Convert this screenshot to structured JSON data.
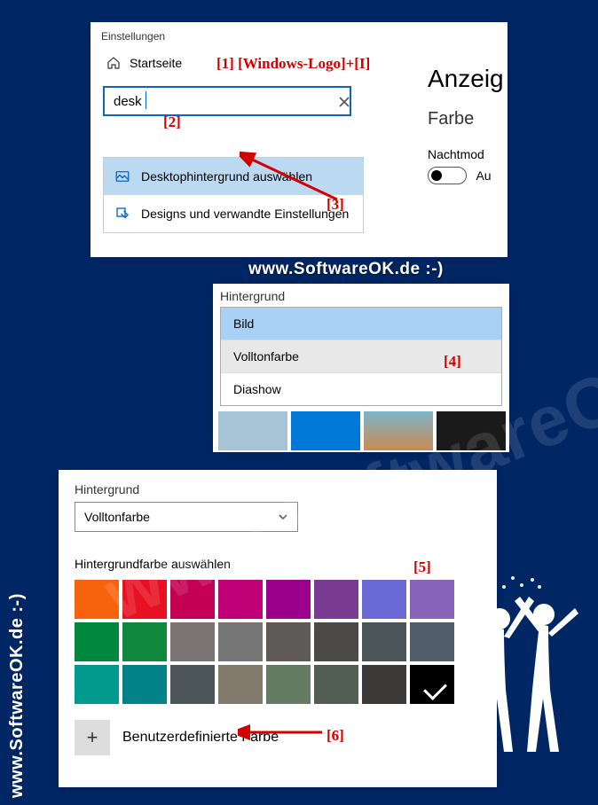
{
  "panel1": {
    "title": "Einstellungen",
    "home_label": "Startseite",
    "search_value": "desk",
    "suggestions": [
      {
        "label": "Desktophintergrund auswählen"
      },
      {
        "label": "Designs und verwandte Einstellungen"
      }
    ],
    "right": {
      "heading": "Anzeig",
      "subheading": "Farbe",
      "night_label": "Nachtmod",
      "toggle_label": "Au"
    }
  },
  "panel2": {
    "label": "Hintergrund",
    "options": [
      "Bild",
      "Volltonfarbe",
      "Diashow"
    ],
    "thumbs": [
      "#a7c3d6",
      "#0078d7",
      "linear-gradient(#7db4c8,#c98a53)",
      "#1a1a1a"
    ]
  },
  "panel3": {
    "label": "Hintergrund",
    "select_value": "Volltonfarbe",
    "sub_label": "Hintergrundfarbe auswählen",
    "colors": [
      "#f7630c",
      "#e81123",
      "#c30052",
      "#bf0077",
      "#9a0089",
      "#7a3b92",
      "#6b69d6",
      "#8764b8",
      "#00893e",
      "#10893e",
      "#7a7574",
      "#767676",
      "#5d5a58",
      "#4c4a48",
      "#4a5459",
      "#515c6b",
      "#009b8e",
      "#038387",
      "#4a5459",
      "#827a6c",
      "#647c64",
      "#525e54",
      "#3b3a39",
      "#000000"
    ],
    "selected_color_index": 23,
    "custom_label": "Benutzerdefinierte Farbe"
  },
  "annotations": {
    "a1": "[1]  [Windows-Logo]+[I]",
    "a2": "[2]",
    "a3": "[3]",
    "a4": "[4]",
    "a5": "[5]",
    "a6": "[6]"
  },
  "watermark": "www.SoftwareOK.de :-)"
}
